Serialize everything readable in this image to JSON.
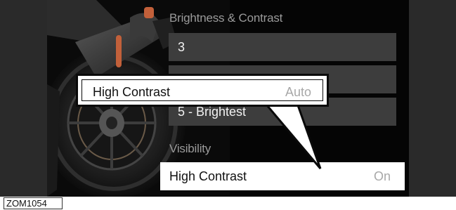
{
  "screen": {
    "brightness_section": {
      "title": "Brightness & Contrast",
      "options": [
        "3",
        "",
        "5 - Brightest"
      ]
    },
    "visibility_section": {
      "title": "Visibility",
      "high_contrast": {
        "label": "High Contrast",
        "value": "On"
      }
    }
  },
  "callout": {
    "label": "High Contrast",
    "value": "Auto"
  },
  "figure_code": "ZOM1054",
  "colors": {
    "screen_background": "#050505",
    "row_background": "#3d3d3d",
    "selected_row": "#ffffff",
    "value_text": "#a8a8a8",
    "bezel": "#2a2a2a"
  },
  "icons": [
    "motorcycle-rear-wheel-image"
  ]
}
